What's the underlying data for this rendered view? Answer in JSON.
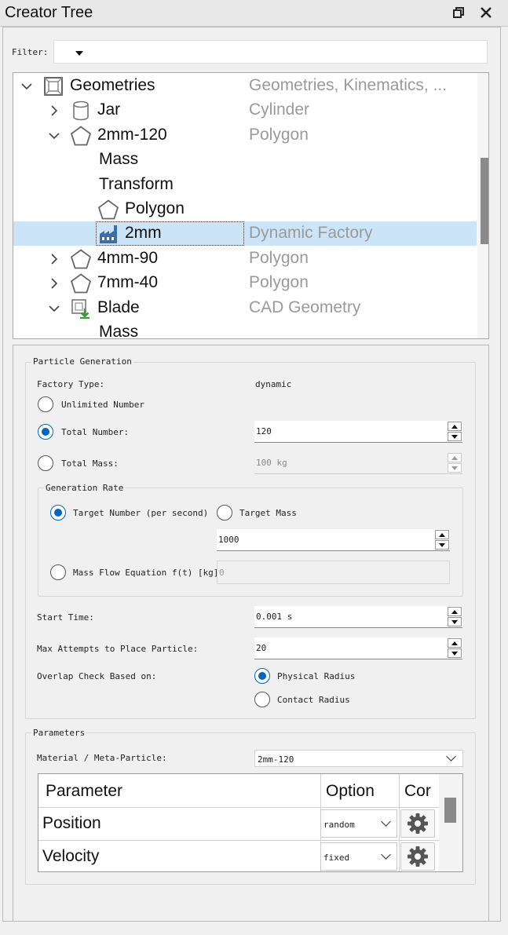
{
  "window": {
    "title": "Creator Tree"
  },
  "filter": {
    "label": "Filter:",
    "value": ""
  },
  "tree": {
    "rows": [
      {
        "label": "Geometries",
        "type": "Geometries, Kinematics, ...",
        "expander": "expanded",
        "icon": "geometries-box-icon"
      },
      {
        "label": "Jar",
        "type": "Cylinder",
        "expander": "collapsed",
        "icon": "cylinder-icon"
      },
      {
        "label": "2mm-120",
        "type": "Polygon",
        "expander": "expanded",
        "icon": "pentagon-icon"
      },
      {
        "label": "Mass",
        "type": "",
        "expander": "none",
        "icon": ""
      },
      {
        "label": "Transform",
        "type": "",
        "expander": "none",
        "icon": ""
      },
      {
        "label": "Polygon",
        "type": "",
        "expander": "none",
        "icon": "pentagon-icon"
      },
      {
        "label": "2mm",
        "type": "Dynamic Factory",
        "expander": "none",
        "icon": "factory-icon",
        "selected": true
      },
      {
        "label": "4mm-90",
        "type": "Polygon",
        "expander": "collapsed",
        "icon": "pentagon-icon"
      },
      {
        "label": "7mm-40",
        "type": "Polygon",
        "expander": "collapsed",
        "icon": "pentagon-icon"
      },
      {
        "label": "Blade",
        "type": "CAD Geometry",
        "expander": "expanded",
        "icon": "cad-import-icon"
      },
      {
        "label": "Mass",
        "type": "",
        "expander": "none",
        "icon": ""
      }
    ]
  },
  "particle_generation": {
    "title": "Particle Generation",
    "factory_type_label": "Factory Type:",
    "factory_type_value": "dynamic",
    "unlimited_label": "Unlimited Number",
    "total_number_label": "Total Number:",
    "total_number_value": "120",
    "total_mass_label": "Total Mass:",
    "total_mass_value": "100 kg",
    "generation_rate": {
      "title": "Generation Rate",
      "target_number_label": "Target Number (per second)",
      "target_mass_label": "Target Mass",
      "rate_value": "1000",
      "mass_flow_label": "Mass Flow Equation f(t) [kg]",
      "mass_flow_value": "0"
    },
    "start_time_label": "Start Time:",
    "start_time_value": "0.001 s",
    "max_attempts_label": "Max Attempts to Place Particle:",
    "max_attempts_value": "20",
    "overlap_label": "Overlap Check Based on:",
    "physical_radius_label": "Physical Radius",
    "contact_radius_label": "Contact Radius"
  },
  "parameters": {
    "title": "Parameters",
    "material_label": "Material / Meta-Particle:",
    "material_value": "2mm-120",
    "table": {
      "headers": [
        "Parameter",
        "Option",
        "Cor"
      ],
      "rows": [
        {
          "parameter": "Position",
          "option": "random"
        },
        {
          "parameter": "Velocity",
          "option": "fixed"
        }
      ]
    }
  },
  "colors": {
    "accent": "#0067c0",
    "selection": "#cce4f7",
    "type_text": "#9a9a9a"
  }
}
